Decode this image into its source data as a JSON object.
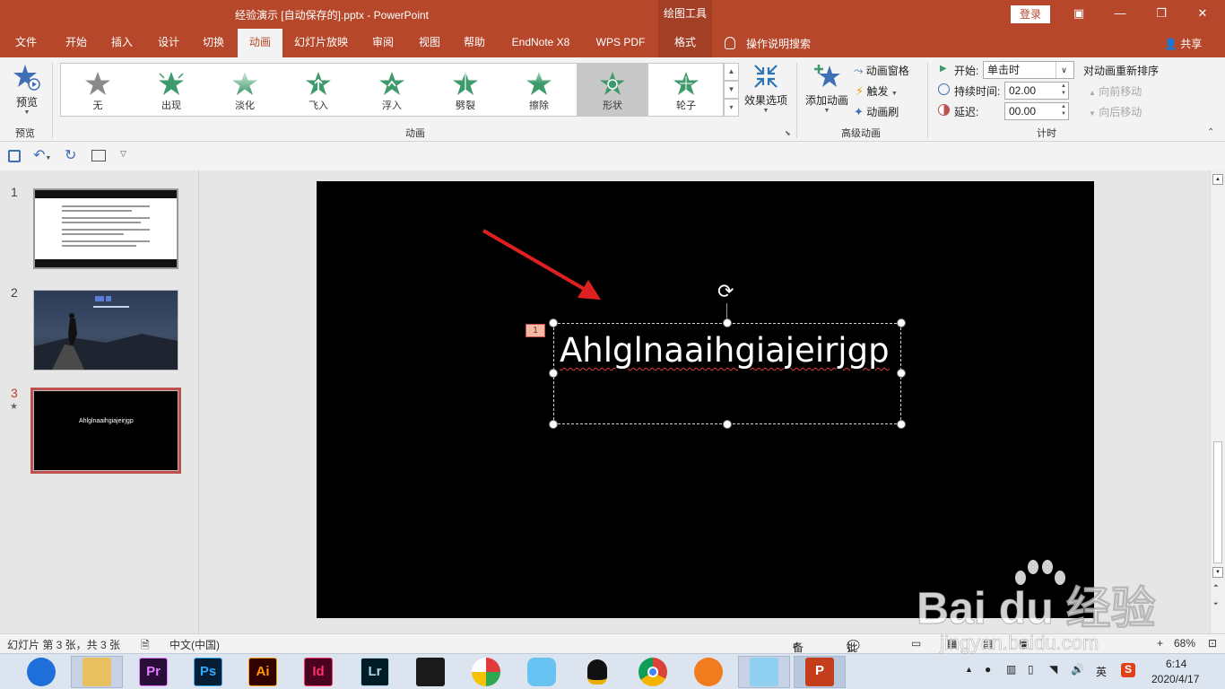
{
  "window": {
    "title": "经验演示 [自动保存的].pptx  -  PowerPoint",
    "context_tools": "绘图工具",
    "login": "登录"
  },
  "tabs": [
    "文件",
    "开始",
    "插入",
    "设计",
    "切换",
    "动画",
    "幻灯片放映",
    "审阅",
    "视图",
    "帮助",
    "EndNote X8",
    "WPS PDF",
    "格式"
  ],
  "active_tab": "动画",
  "tell_me": "操作说明搜索",
  "share": "共享",
  "ribbon": {
    "preview_button": "预览",
    "preview_group": "预览",
    "animations": [
      "无",
      "出现",
      "淡化",
      "飞入",
      "浮入",
      "劈裂",
      "擦除",
      "形状",
      "轮子"
    ],
    "selected_animation": "形状",
    "effect_options": "效果选项",
    "animation_group": "动画",
    "add_animation": "添加动画",
    "animation_pane": "动画窗格",
    "trigger": "触发",
    "animation_painter": "动画刷",
    "advanced_group": "高级动画",
    "start_label": "开始:",
    "start_value": "单击时",
    "duration_label": "持续时间:",
    "duration_value": "02.00",
    "delay_label": "延迟:",
    "delay_value": "00.00",
    "timing_group": "计时",
    "reorder_title": "对动画重新排序",
    "move_earlier": "向前移动",
    "move_later": "向后移动"
  },
  "slides": [
    {
      "number": "1",
      "thumb_text": ""
    },
    {
      "number": "2",
      "thumb_text": ""
    },
    {
      "number": "3",
      "thumb_text": "Ahlglnaaihgiajeirjgp"
    }
  ],
  "current_slide": {
    "text": "Ahlglnaaihgiajeirjgp",
    "animation_tag": "1"
  },
  "statusbar": {
    "slide_info": "幻灯片 第 3 张，共 3 张",
    "language": "中文(中国)",
    "notes": "备注",
    "comments": "批注",
    "zoom": "68%"
  },
  "taskbar": {
    "apps": [
      "Pr",
      "Ps",
      "Ai",
      "Id",
      "Lr"
    ],
    "ime": "英",
    "time": "6:14",
    "date": "2020/4/17"
  },
  "watermark": {
    "brand": "Bai du 经验",
    "url": "jingyan.baidu.com"
  },
  "colors": {
    "accent": "#b7472a",
    "selection_outline": "#c0504d",
    "arrow": "#e02020"
  }
}
